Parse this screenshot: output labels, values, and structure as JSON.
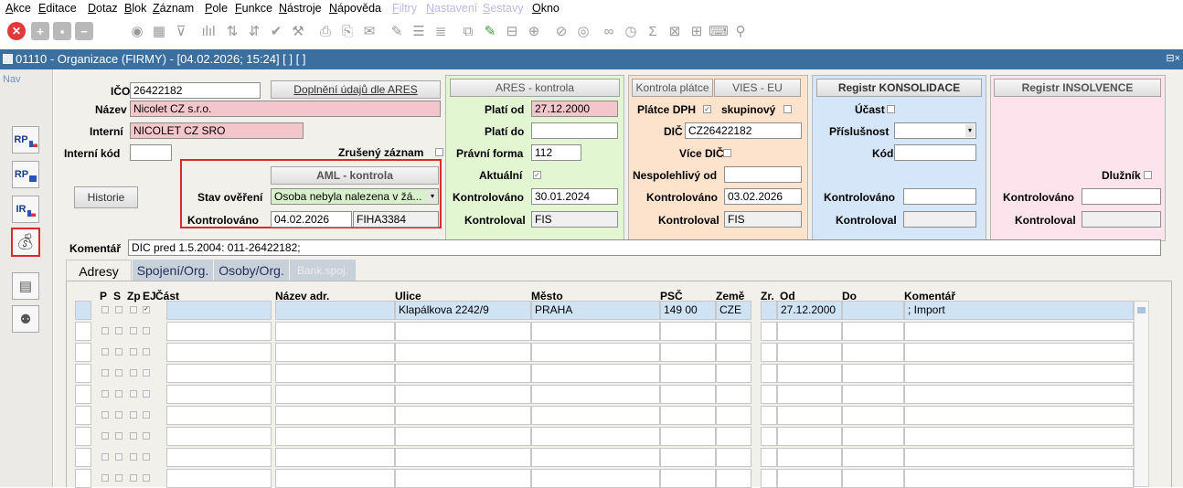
{
  "menu": [
    "Akce",
    "Editace",
    "Dotaz",
    "Blok",
    "Záznam",
    "Pole",
    "Funkce",
    "Nástroje",
    "Nápověda",
    "Filtry",
    "Nastavení",
    "Sestavy",
    "Okno"
  ],
  "window": {
    "title": "01110 - Organizace (FIRMY) - [04.02.2026; 15:24] [ ] [ ]",
    "controls": "⊟×"
  },
  "nav": {
    "label": "Nav",
    "buttons": [
      "RP",
      "RP",
      "IR",
      "",
      "",
      ""
    ]
  },
  "form": {
    "ico_label": "IČO",
    "ico": "26422182",
    "ares_fill_button": "Doplnění údajů dle ARES",
    "nazev_label": "Název",
    "nazev": "Nicolet CZ s.r.o.",
    "interni_label": "Interní",
    "interni": "NICOLET CZ SRO",
    "interni_kod_label": "Interní kód",
    "interni_kod": "",
    "zruseny_label": "Zrušený záznam",
    "historie_button": "Historie",
    "komentar_label": "Komentář",
    "komentar": "DIC pred 1.5.2004: 011-26422182;"
  },
  "aml": {
    "header": "AML - kontrola",
    "stav_label": "Stav ověření",
    "stav": "Osoba nebyla nalezena v žá...",
    "kontrolovano_label": "Kontrolováno",
    "kontrolovano": "04.02.2026",
    "kontroloval": "FIHA3384"
  },
  "ares": {
    "header": "ARES - kontrola",
    "plati_od_label": "Platí od",
    "plati_od": "27.12.2000",
    "plati_do_label": "Platí do",
    "plati_do": "",
    "pravni_forma_label": "Právní forma",
    "pravni_forma": "112",
    "aktualni_label": "Aktuální",
    "kontrolovano_label": "Kontrolováno",
    "kontrolovano": "30.01.2024",
    "kontroloval_label": "Kontroloval",
    "kontroloval": "FIS"
  },
  "vies": {
    "header_left": "Kontrola plátce",
    "header_right": "VIES - EU",
    "platce_label": "Plátce DPH",
    "skupinovy_label": "skupinový",
    "dic_label": "DIČ",
    "dic": "CZ26422182",
    "vice_dic_label": "Více DIČ",
    "nespolehlivy_label": "Nespolehlivý od",
    "nespolehlivy": "",
    "kontrolovano_label": "Kontrolováno",
    "kontrolovano": "03.02.2026",
    "kontroloval_label": "Kontroloval",
    "kontroloval": "FIS"
  },
  "konsolidace": {
    "header": "Registr KONSOLIDACE",
    "ucast_label": "Účast",
    "prislusnost_label": "Příslušnost",
    "kod_label": "Kód",
    "kontrolovano_label": "Kontrolováno",
    "kontroloval_label": "Kontroloval"
  },
  "insolvence": {
    "header": "Registr INSOLVENCE",
    "dluznik_label": "Dlužník",
    "kontrolovano_label": "Kontrolováno",
    "kontroloval_label": "Kontroloval"
  },
  "tabs": [
    "Adresy",
    "Spojení/Org.",
    "Osoby/Org.",
    "Bank.spoj."
  ],
  "table": {
    "headers": [
      "P",
      "S",
      "Zp",
      "EJ",
      "Část",
      "Název adr.",
      "Ulice",
      "Město",
      "PSČ",
      "Země",
      "Zr.",
      "Od",
      "Do",
      "Komentář"
    ],
    "row1": {
      "ulice": "Klapálkova 2242/9",
      "mesto": "PRAHA",
      "psc": "149 00",
      "zeme": "CZE",
      "od": "27.12.2000",
      "komentar": "; Import"
    }
  },
  "colors": {
    "title_bar": "#3b6f9f",
    "pink": "#f3c6cc",
    "green": "#e2f6d2",
    "orange": "#fde3cc",
    "blue": "#d4e6f7",
    "rose": "#fde4ec",
    "highlight_border": "#d92b2b"
  }
}
